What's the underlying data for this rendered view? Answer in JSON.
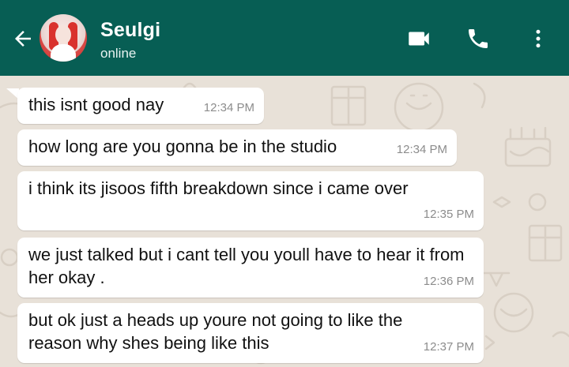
{
  "header": {
    "contact_name": "Seulgi",
    "status": "online",
    "colors": {
      "bar": "#075e54",
      "chat_bg": "#e8e1d8"
    },
    "icons": [
      "back-arrow-icon",
      "video-call-icon",
      "phone-icon",
      "more-vertical-icon"
    ]
  },
  "messages": [
    {
      "text": "this isnt good nay",
      "time": "12:34 PM"
    },
    {
      "text": "how long are you gonna be in the studio",
      "time": "12:34 PM"
    },
    {
      "text": "i think its jisoos fifth breakdown since i came over",
      "time": "12:35 PM"
    },
    {
      "text": "we just talked but i cant tell you youll have to hear it from her okay .",
      "time": "12:36 PM"
    },
    {
      "text": "but ok just a heads up youre not going to like the reason why shes being like this",
      "time": "12:37 PM"
    }
  ]
}
